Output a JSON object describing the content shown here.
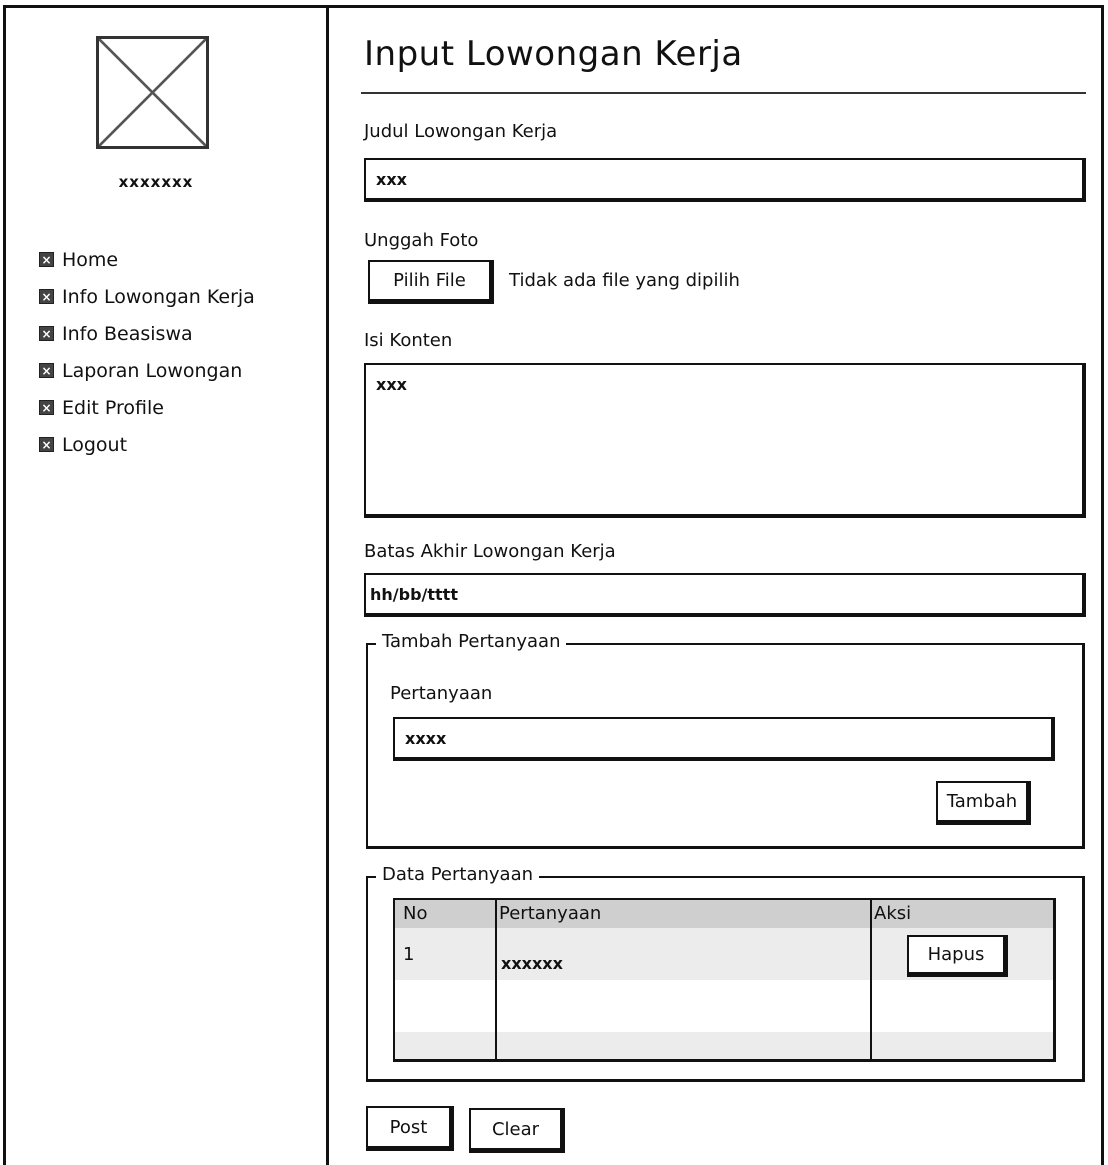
{
  "sidebar": {
    "username": "xxxxxxx",
    "items": [
      {
        "label": "Home"
      },
      {
        "label": "Info Lowongan Kerja"
      },
      {
        "label": "Info Beasiswa"
      },
      {
        "label": "Laporan Lowongan"
      },
      {
        "label": "Edit Profile"
      },
      {
        "label": "Logout"
      }
    ]
  },
  "main": {
    "title": "Input Lowongan Kerja",
    "judul": {
      "label": "Judul Lowongan Kerja",
      "value": "xxx"
    },
    "foto": {
      "label": "Unggah Foto",
      "button": "Pilih File",
      "status": "Tidak ada file yang dipilih"
    },
    "konten": {
      "label": "Isi Konten",
      "value": "xxx"
    },
    "batas": {
      "label": "Batas Akhir Lowongan Kerja",
      "value": "hh/bb/tttt"
    },
    "tambah": {
      "legend": "Tambah Pertanyaan",
      "label": "Pertanyaan",
      "value": "xxxx",
      "button": "Tambah"
    },
    "data": {
      "legend": "Data Pertanyaan",
      "columns": [
        "No",
        "Pertanyaan",
        "Aksi"
      ],
      "rows": [
        {
          "no": "1",
          "pertanyaan": "xxxxxx",
          "action": "Hapus"
        }
      ]
    },
    "actions": {
      "post": "Post",
      "clear": "Clear"
    }
  }
}
